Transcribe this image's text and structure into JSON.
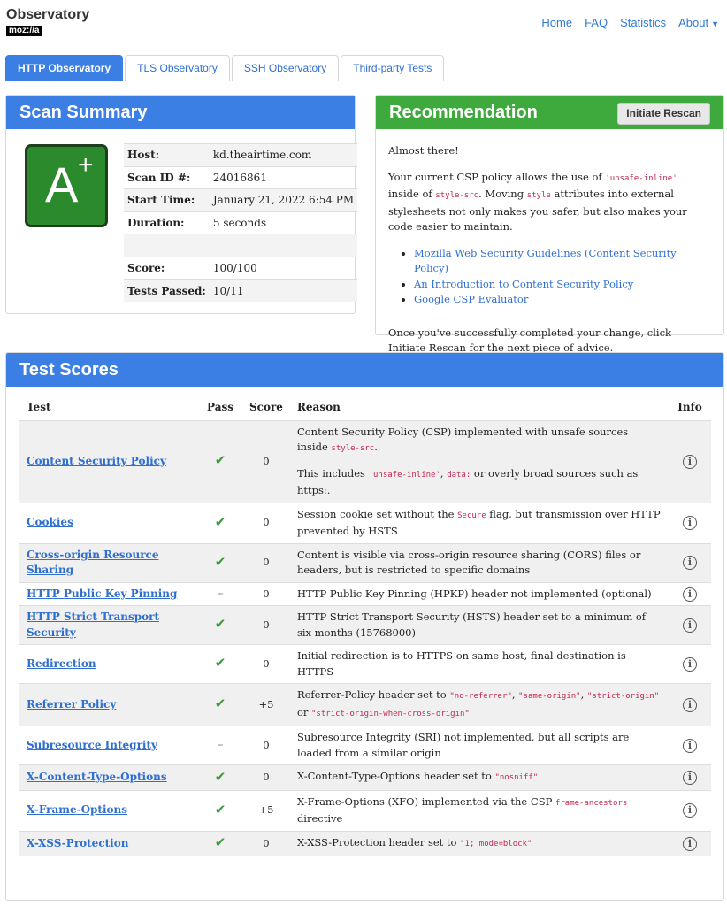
{
  "header": {
    "brand": "Observatory",
    "logo": "moz://a",
    "nav": [
      "Home",
      "FAQ",
      "Statistics",
      "About"
    ]
  },
  "tabs": [
    "HTTP Observatory",
    "TLS Observatory",
    "SSH Observatory",
    "Third-party Tests"
  ],
  "scan_summary": {
    "title": "Scan Summary",
    "grade": "A",
    "grade_modifier": "+",
    "rows": [
      {
        "key": "Host:",
        "value": "kd.theairtime.com"
      },
      {
        "key": "Scan ID #:",
        "value": "24016861"
      },
      {
        "key": "Start Time:",
        "value": "January 21, 2022 6:54 PM"
      },
      {
        "key": "Duration:",
        "value": "5 seconds"
      },
      {
        "key": "",
        "value": ""
      },
      {
        "key": "Score:",
        "value": "100/100"
      },
      {
        "key": "Tests Passed:",
        "value": "10/11"
      }
    ]
  },
  "recommendation": {
    "title": "Recommendation",
    "button": "Initiate Rescan",
    "intro": "Almost there!",
    "p1": [
      "Your current CSP policy allows the use of ",
      "'unsafe-inline'",
      " inside of ",
      "style-src",
      ". Moving ",
      "style",
      " attributes into external stylesheets not only makes you safer, but also makes your code easier to maintain."
    ],
    "links": [
      "Mozilla Web Security Guidelines (Content Security Policy)",
      "An Introduction to Content Security Policy",
      "Google CSP Evaluator"
    ],
    "outro": "Once you've successfully completed your change, click Initiate Rescan for the next piece of advice."
  },
  "test_scores": {
    "title": "Test Scores",
    "columns": [
      "Test",
      "Pass",
      "Score",
      "Reason",
      "Info"
    ],
    "rows": [
      {
        "test": "Content Security Policy",
        "pass": "check",
        "score": "0",
        "reason": [
          [
            "Content Security Policy (CSP) implemented with unsafe sources inside ",
            "style-src",
            "."
          ],
          [
            "This includes ",
            "'unsafe-inline'",
            ", ",
            "data:",
            " or overly broad sources such as https:."
          ]
        ]
      },
      {
        "test": "Cookies",
        "pass": "check",
        "score": "0",
        "reason": [
          [
            "Session cookie set without the ",
            "Secure",
            " flag, but transmission over HTTP prevented by HSTS"
          ]
        ]
      },
      {
        "test": "Cross-origin Resource Sharing",
        "pass": "check",
        "score": "0",
        "reason": [
          [
            "Content is visible via cross-origin resource sharing (CORS) files or headers, but is restricted to specific domains"
          ]
        ]
      },
      {
        "test": "HTTP Public Key Pinning",
        "pass": "dash",
        "score": "0",
        "reason": [
          [
            "HTTP Public Key Pinning (HPKP) header not implemented (optional)"
          ]
        ]
      },
      {
        "test": "HTTP Strict Transport Security",
        "pass": "check",
        "score": "0",
        "reason": [
          [
            "HTTP Strict Transport Security (HSTS) header set to a minimum of six months (15768000)"
          ]
        ]
      },
      {
        "test": "Redirection",
        "pass": "check",
        "score": "0",
        "reason": [
          [
            "Initial redirection is to HTTPS on same host, final destination is HTTPS"
          ]
        ]
      },
      {
        "test": "Referrer Policy",
        "pass": "check",
        "score": "+5",
        "reason": [
          [
            "Referrer-Policy header set to ",
            "\"no-referrer\"",
            ", ",
            "\"same-origin\"",
            ", ",
            "\"strict-origin\"",
            " or ",
            "\"strict-origin-when-cross-origin\""
          ]
        ]
      },
      {
        "test": "Subresource Integrity",
        "pass": "dash",
        "score": "0",
        "reason": [
          [
            "Subresource Integrity (SRI) not implemented, but all scripts are loaded from a similar origin"
          ]
        ]
      },
      {
        "test": "X-Content-Type-Options",
        "pass": "check",
        "score": "0",
        "reason": [
          [
            "X-Content-Type-Options header set to ",
            "\"nosniff\""
          ]
        ]
      },
      {
        "test": "X-Frame-Options",
        "pass": "check",
        "score": "+5",
        "reason": [
          [
            "X-Frame-Options (XFO) implemented via the CSP ",
            "frame-ancestors",
            " directive"
          ]
        ]
      },
      {
        "test": "X-XSS-Protection",
        "pass": "check",
        "score": "0",
        "reason": [
          [
            "X-XSS-Protection header set to ",
            "\"1; mode=block\""
          ]
        ]
      }
    ]
  },
  "icons": {
    "pass": "check-icon",
    "na": "dash-icon",
    "info": "info-icon",
    "caret": "caret-down-icon"
  }
}
